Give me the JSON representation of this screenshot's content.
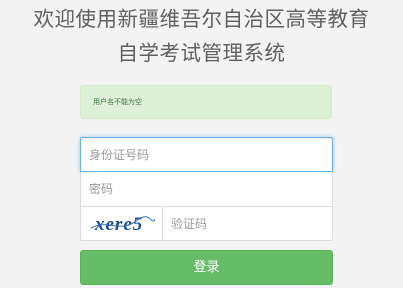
{
  "header": {
    "title_line1": "欢迎使用新疆维吾尔自治区高等教育",
    "title_line2": "自学考试管理系统"
  },
  "alert": {
    "message": "用户名不能为空"
  },
  "form": {
    "id_placeholder": "身份证号码",
    "password_placeholder": "密码",
    "captcha_text": "xere5",
    "captcha_placeholder": "验证码",
    "login_label": "登录"
  },
  "colors": {
    "background": "#f3f3f3",
    "alert_bg": "#dff0d8",
    "alert_text": "#3c763d",
    "focus_border": "#66afe9",
    "button_bg": "#5cb85c",
    "title_text": "#5f5f5f"
  }
}
